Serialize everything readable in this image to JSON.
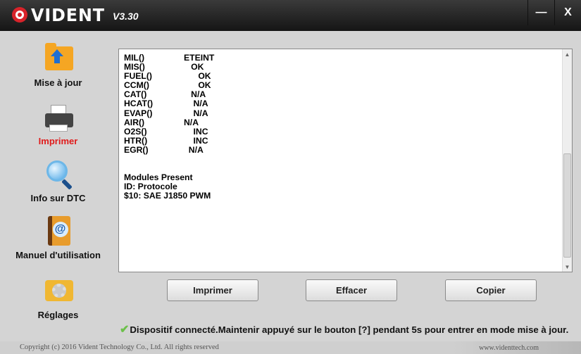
{
  "app": {
    "logo": "VIDENT",
    "version": "V3.30"
  },
  "window_controls": {
    "minimize": "—",
    "close": "X"
  },
  "sidebar": {
    "items": [
      {
        "label": "Mise à jour",
        "icon": "update-folder-icon"
      },
      {
        "label": "Imprimer",
        "icon": "printer-icon",
        "active": true
      },
      {
        "label": "Info sur DTC",
        "icon": "magnifier-icon"
      },
      {
        "label": "Manuel d'utilisation",
        "icon": "manual-book-icon"
      },
      {
        "label": "Réglages",
        "icon": "settings-gear-icon"
      }
    ]
  },
  "output": {
    "lines": [
      {
        "k": "MIL()",
        "v": "ETEINT"
      },
      {
        "k": "MIS()",
        "v": "   OK"
      },
      {
        "k": "FUEL()",
        "v": "      OK"
      },
      {
        "k": "CCM()",
        "v": "      OK"
      },
      {
        "k": "CAT()",
        "v": "   N/A"
      },
      {
        "k": "HCAT()",
        "v": "    N/A"
      },
      {
        "k": "EVAP()",
        "v": "    N/A"
      },
      {
        "k": "AIR()",
        "v": "N/A"
      },
      {
        "k": "O2S()",
        "v": "    INC"
      },
      {
        "k": "HTR()",
        "v": "    INC"
      },
      {
        "k": "EGR()",
        "v": "  N/A"
      },
      {
        "k": "",
        "v": ""
      },
      {
        "k": "",
        "v": ""
      },
      {
        "k": "Modules Present",
        "v": ""
      },
      {
        "k": "ID: Protocole",
        "v": ""
      },
      {
        "k": "$10: SAE J1850 PWM",
        "v": ""
      }
    ]
  },
  "buttons": {
    "print": "Imprimer",
    "clear": "Effacer",
    "copy": "Copier"
  },
  "status": {
    "message": "Dispositif connecté.Maintenir appuyé sur le bouton [?] pendant 5s pour entrer en mode mise à jour."
  },
  "footer": {
    "copyright": "Copyright (c) 2016 Vident Technology Co., Ltd. All rights reserved",
    "website": "www.videnttech.com"
  },
  "colors": {
    "active": "#e01b1b",
    "title_bar": "#1f1f1f",
    "accent_check": "#6cc04a"
  }
}
